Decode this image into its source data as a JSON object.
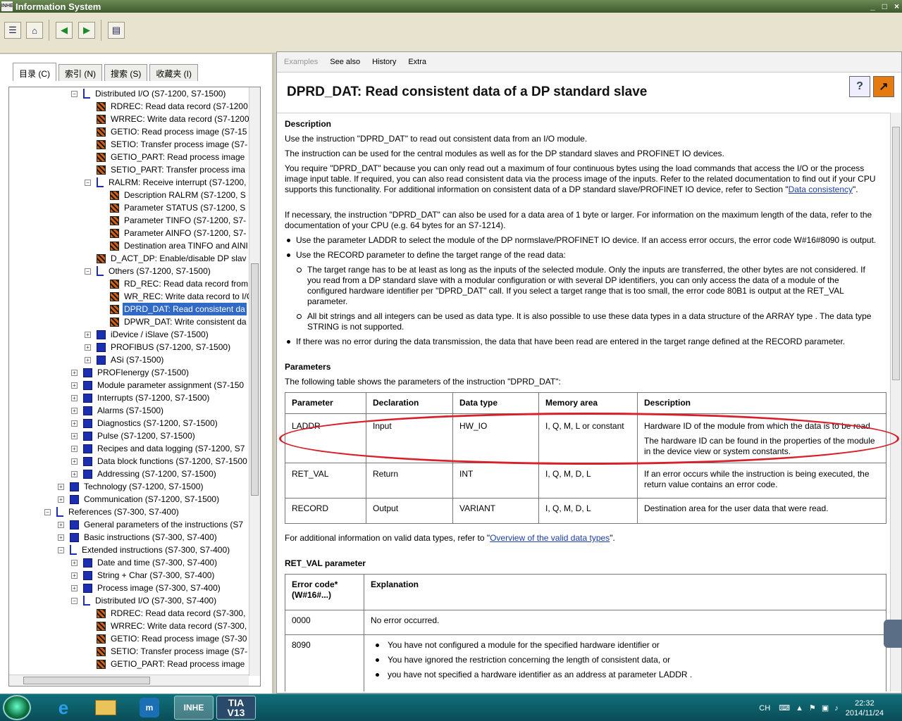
{
  "window": {
    "title": "Information System",
    "app_icon_text": "INHE",
    "btn_min": "_",
    "btn_max": "□",
    "btn_close": "×"
  },
  "toolbar": {
    "buttons": [
      {
        "icon": "toc-icon",
        "glyph": "☰"
      },
      {
        "icon": "home-icon",
        "glyph": "⌂"
      },
      {
        "icon": "back-icon",
        "glyph": "◀"
      },
      {
        "icon": "forward-icon",
        "glyph": "▶"
      },
      {
        "icon": "print-icon",
        "glyph": "▤"
      }
    ]
  },
  "left_tabs": [
    "目录 (C)",
    "索引 (N)",
    "搜索 (S)",
    "收藏夹 (I)"
  ],
  "tree": [
    {
      "d": 2,
      "t": "Distributed I/O (S7-1200, S7-1500)",
      "ic": "open",
      "ex": "−"
    },
    {
      "d": 3,
      "t": "RDREC: Read data record (S7-1200",
      "ic": "page"
    },
    {
      "d": 3,
      "t": "WRREC: Write data record (S7-1200",
      "ic": "page"
    },
    {
      "d": 3,
      "t": "GETIO: Read process image (S7-15",
      "ic": "page"
    },
    {
      "d": 3,
      "t": "SETIO: Transfer process image (S7-",
      "ic": "page"
    },
    {
      "d": 3,
      "t": "GETIO_PART: Read process image",
      "ic": "page"
    },
    {
      "d": 3,
      "t": "SETIO_PART: Transfer process ima",
      "ic": "page"
    },
    {
      "d": 3,
      "t": "RALRM: Receive interrupt (S7-1200,",
      "ic": "open",
      "ex": "−"
    },
    {
      "d": 4,
      "t": "Description RALRM (S7-1200, S",
      "ic": "page"
    },
    {
      "d": 4,
      "t": "Parameter STATUS (S7-1200, S",
      "ic": "page"
    },
    {
      "d": 4,
      "t": "Parameter TINFO (S7-1200, S7-",
      "ic": "page"
    },
    {
      "d": 4,
      "t": "Parameter AINFO (S7-1200, S7-",
      "ic": "page"
    },
    {
      "d": 4,
      "t": "Destination area TINFO and AINI",
      "ic": "page"
    },
    {
      "d": 3,
      "t": "D_ACT_DP: Enable/disable DP slav",
      "ic": "page"
    },
    {
      "d": 3,
      "t": "Others (S7-1200, S7-1500)",
      "ic": "open",
      "ex": "−"
    },
    {
      "d": 4,
      "t": "RD_REC: Read data record from",
      "ic": "page"
    },
    {
      "d": 4,
      "t": "WR_REC: Write data record to I/O",
      "ic": "page"
    },
    {
      "d": 4,
      "t": "DPRD_DAT: Read consistent da",
      "ic": "page",
      "sel": true
    },
    {
      "d": 4,
      "t": "DPWR_DAT: Write consistent da",
      "ic": "page"
    },
    {
      "d": 3,
      "t": "iDevice / iSlave (S7-1500)",
      "ic": "book",
      "ex": "+"
    },
    {
      "d": 3,
      "t": "PROFIBUS (S7-1200, S7-1500)",
      "ic": "book",
      "ex": "+"
    },
    {
      "d": 3,
      "t": "ASi (S7-1500)",
      "ic": "book",
      "ex": "+"
    },
    {
      "d": 2,
      "t": "PROFIenergy (S7-1500)",
      "ic": "book",
      "ex": "+"
    },
    {
      "d": 2,
      "t": "Module parameter assignment (S7-150",
      "ic": "book",
      "ex": "+"
    },
    {
      "d": 2,
      "t": "Interrupts (S7-1200, S7-1500)",
      "ic": "book",
      "ex": "+"
    },
    {
      "d": 2,
      "t": "Alarms (S7-1500)",
      "ic": "book",
      "ex": "+"
    },
    {
      "d": 2,
      "t": "Diagnostics (S7-1200, S7-1500)",
      "ic": "book",
      "ex": "+"
    },
    {
      "d": 2,
      "t": "Pulse (S7-1200, S7-1500)",
      "ic": "book",
      "ex": "+"
    },
    {
      "d": 2,
      "t": "Recipes and data logging (S7-1200, S7",
      "ic": "book",
      "ex": "+"
    },
    {
      "d": 2,
      "t": "Data block functions (S7-1200, S7-1500",
      "ic": "book",
      "ex": "+"
    },
    {
      "d": 2,
      "t": "Addressing (S7-1200, S7-1500)",
      "ic": "book",
      "ex": "+"
    },
    {
      "d": 1,
      "t": "Technology (S7-1200, S7-1500)",
      "ic": "book",
      "ex": "+"
    },
    {
      "d": 1,
      "t": "Communication (S7-1200, S7-1500)",
      "ic": "book",
      "ex": "+"
    },
    {
      "d": 0,
      "t": "References (S7-300, S7-400)",
      "ic": "open",
      "ex": "−"
    },
    {
      "d": 1,
      "t": "General parameters of the instructions (S7",
      "ic": "book",
      "ex": "+"
    },
    {
      "d": 1,
      "t": "Basic instructions (S7-300, S7-400)",
      "ic": "book",
      "ex": "+"
    },
    {
      "d": 1,
      "t": "Extended instructions (S7-300, S7-400)",
      "ic": "open",
      "ex": "−"
    },
    {
      "d": 2,
      "t": "Date and time (S7-300, S7-400)",
      "ic": "book",
      "ex": "+"
    },
    {
      "d": 2,
      "t": "String + Char (S7-300, S7-400)",
      "ic": "book",
      "ex": "+"
    },
    {
      "d": 2,
      "t": "Process image (S7-300, S7-400)",
      "ic": "book",
      "ex": "+"
    },
    {
      "d": 2,
      "t": "Distributed I/O (S7-300, S7-400)",
      "ic": "open",
      "ex": "−"
    },
    {
      "d": 3,
      "t": "RDREC: Read data record (S7-300,",
      "ic": "page"
    },
    {
      "d": 3,
      "t": "WRREC: Write data record (S7-300,",
      "ic": "page"
    },
    {
      "d": 3,
      "t": "GETIO: Read process image (S7-30",
      "ic": "page"
    },
    {
      "d": 3,
      "t": "SETIO: Transfer process image (S7-",
      "ic": "page"
    },
    {
      "d": 3,
      "t": "GETIO_PART: Read process image",
      "ic": "page"
    }
  ],
  "linkbar": [
    "Examples",
    "See also",
    "History",
    "Extra"
  ],
  "doc": {
    "title": "DPRD_DAT: Read consistent data of a DP standard slave",
    "desc_h": "Description",
    "p1": "Use the instruction \"DPRD_DAT\" to read out consistent data from an I/O module.",
    "p2": "The instruction can be used for the central modules as well as for the DP standard slaves and PROFINET IO devices.",
    "p3a": "You require \"DPRD_DAT\" because you can only read out a maximum of four continuous bytes using the load commands that access the I/O or the process image input table. If required, you can also read consistent data via the process image of the inputs. Refer to the related documentation to find out if your CPU supports this functionality. For additional information on consistent data of a DP standard slave/PROFINET IO device, refer to Section \"",
    "p3link": "Data consistency",
    "p3b": "\".",
    "p4": "If necessary, the instruction \"DPRD_DAT\" can also be used for a data area of 1 byte or larger. For information on the maximum length of the data, refer to the documentation of your CPU (e.g. 64 bytes for an S7-1214).",
    "b1": "Use the parameter LADDR to select the module of the DP normslave/PROFINET IO device. If an access error occurs, the error code W#16#8090 is output.",
    "b2": "Use the RECORD parameter to define the target range of the read data:",
    "s1": "The target range has to be at least as long as the inputs of the selected module. Only the inputs are transferred, the other bytes are not considered. If you read from a DP standard slave with a modular configuration or with several DP identifiers, you can only access the data of a module of the configured hardware identifier per \"DPRD_DAT\" call. If you select a target range that is too small, the error code 80B1 is output at the RET_VAL parameter.",
    "s2": "All bit strings and all integers can be used as data type. It is also possible to use these data types in a data structure of the ARRAY type . The data type STRING is not supported.",
    "b3": "If there was no error during the data transmission, the data that have been read are entered in the target range defined at the RECORD parameter.",
    "params_h": "Parameters",
    "params_intro": "The following table shows the parameters of the instruction \"DPRD_DAT\":",
    "ptable": {
      "headers": [
        "Parameter",
        "Declaration",
        "Data type",
        "Memory area",
        "Description"
      ],
      "rows": [
        [
          "LADDR",
          "Input",
          "HW_IO",
          "I, Q, M, L or constant",
          "Hardware ID of the module from which the data is to be read.",
          "The hardware ID can be found in the properties of the module in the device view or system constants."
        ],
        [
          "RET_VAL",
          "Return",
          "INT",
          "I, Q, M, D, L",
          "If an error occurs while the instruction is being executed, the return value contains an error code.",
          ""
        ],
        [
          "RECORD",
          "Output",
          "VARIANT",
          "I, Q, M, D, L",
          "Destination area for the user data that were read.",
          ""
        ]
      ]
    },
    "more_a": "For additional information on valid data types, refer to \"",
    "more_link": "Overview of the valid data types",
    "more_b": "\".",
    "ret_h": "RET_VAL parameter",
    "rtable": {
      "h1": "Error code* (W#16#...)",
      "h2": "Explanation",
      "r1c": "0000",
      "r1e": "No error occurred.",
      "r2c": "8090",
      "r2e": [
        "You have not configured a module for the specified hardware identifier or",
        "You have ignored the restriction concerning the length of consistent data, or",
        "you have not specified a hardware identifier as an address at parameter LADDR ."
      ]
    }
  },
  "taskbar": {
    "tia": "TIA",
    "tia2": "V13",
    "inhe": "INHE",
    "lang": "CH",
    "time": "22:32",
    "date": "2014/11/24"
  },
  "colors": {
    "highlight": "#3169c6",
    "annotation": "#d8202a"
  }
}
